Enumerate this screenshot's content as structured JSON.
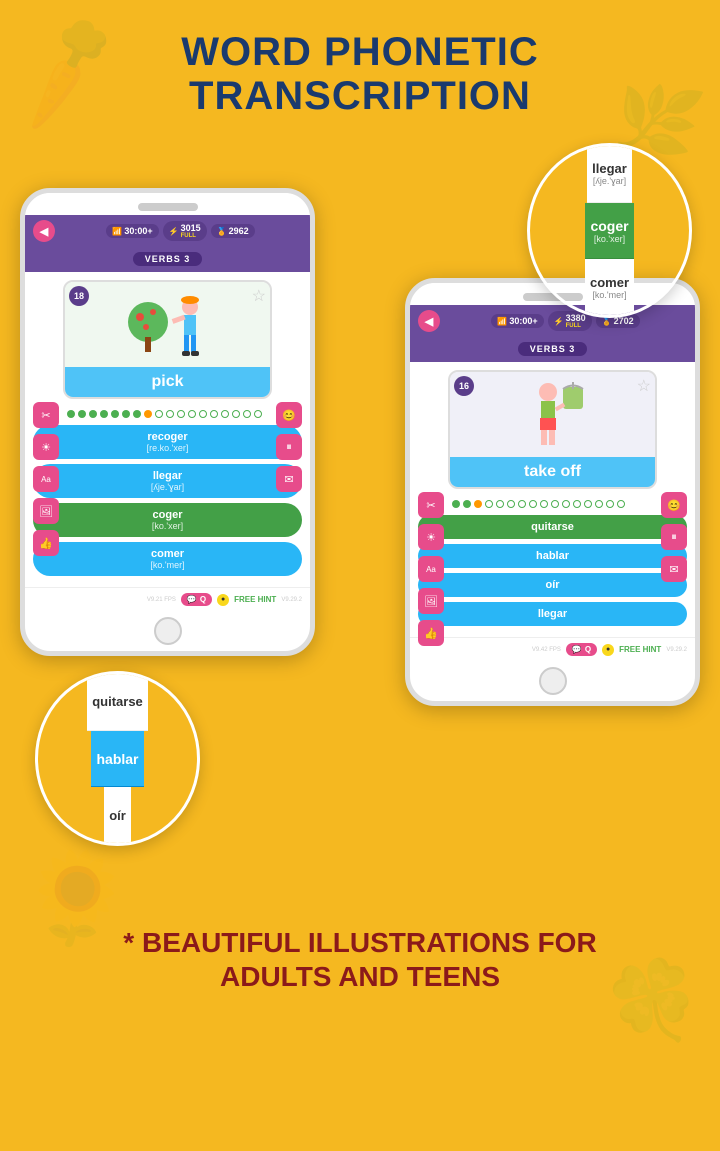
{
  "header": {
    "title_line1": "WORD PHONETIC",
    "title_line2": "TRANSCRIPTION"
  },
  "left_phone": {
    "speaker": "",
    "stats": {
      "time": "30:00+",
      "points": "3015",
      "full_label": "FULL",
      "coins": "2962"
    },
    "section": "VERBS 3",
    "card": {
      "number": "18",
      "word": "pick",
      "emoji": "🌳🍎🧑"
    },
    "answers": [
      {
        "word": "recoger",
        "phonetic": "[re.ko.'xer]",
        "type": "blue"
      },
      {
        "word": "llegar",
        "phonetic": "[ʎje.'ɣar]",
        "type": "blue"
      },
      {
        "word": "coger",
        "phonetic": "[ko.'xer]",
        "type": "green"
      },
      {
        "word": "comer",
        "phonetic": "[ko.'mer]",
        "type": "blue"
      }
    ],
    "hint": "FREE HINT",
    "fps": "V9.21 FPS",
    "version": "V9.29.2"
  },
  "right_phone": {
    "stats": {
      "time": "30:00+",
      "points": "3380",
      "full_label": "FULL",
      "coins": "2702"
    },
    "section": "VERBS 3",
    "card": {
      "number": "16",
      "word": "take off",
      "emoji": "🧑👕"
    },
    "answers": [
      {
        "word": "quitarse",
        "type": "green"
      },
      {
        "word": "hablar",
        "type": "blue"
      },
      {
        "word": "oír",
        "type": "blue"
      },
      {
        "word": "llegar",
        "type": "blue"
      }
    ],
    "hint": "FREE HINT",
    "fps": "V9.42 FPS",
    "version": "V9.29.2"
  },
  "bubble_right": {
    "items": [
      {
        "word": "llegar",
        "phonetic": "[ʎje.'ɣar]",
        "type": "white"
      },
      {
        "word": "coger",
        "phonetic": "[ko.'xer]",
        "type": "green"
      },
      {
        "word": "comer",
        "phonetic": "[ko.'mer]",
        "type": "white"
      }
    ]
  },
  "bubble_left": {
    "items": [
      {
        "word": "quitarse",
        "type": "white"
      },
      {
        "word": "hablar",
        "type": "green"
      },
      {
        "word": "oír",
        "type": "white"
      }
    ]
  },
  "footer": {
    "line1": "* BEAUTIFUL ILLUSTRATIONS FOR",
    "line2": "ADULTS AND TEENS"
  },
  "icons": {
    "back_arrow": "◀",
    "wifi": "📶",
    "bolt": "⚡",
    "medal": "🏅",
    "scissors": "✂",
    "sun": "☀",
    "text_a": "Aa",
    "image": "🖼",
    "thumb": "👍",
    "face": "😊",
    "pause": "⏸",
    "mail": "✉",
    "star": "★",
    "star_outline": "☆",
    "coin": "●",
    "hint_icon": "💬",
    "back_arrow_r": "◀"
  }
}
